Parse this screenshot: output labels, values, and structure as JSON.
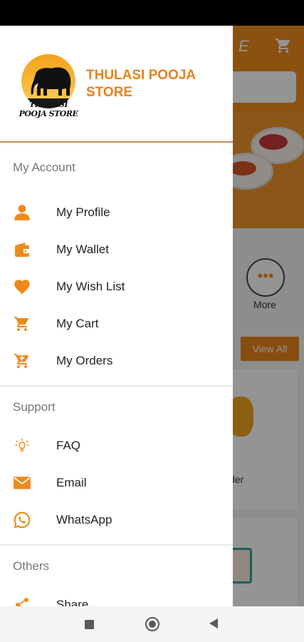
{
  "brand": {
    "name_line1": "THULASI POOJA",
    "name_line2": "STORE",
    "logo_text": "THULASI POOJA STORE",
    "accent_color": "#e6821b"
  },
  "background": {
    "title_fragment": "E",
    "more_label": "More",
    "view_all_label": "View All",
    "card_label_fragment": "der"
  },
  "drawer": {
    "sections": [
      {
        "title": "My Account",
        "items": [
          {
            "label": "My Profile",
            "icon": "person-icon"
          },
          {
            "label": "My Wallet",
            "icon": "wallet-icon"
          },
          {
            "label": "My Wish List",
            "icon": "heart-icon"
          },
          {
            "label": "My Cart",
            "icon": "cart-icon"
          },
          {
            "label": "My Orders",
            "icon": "orders-cart-icon"
          }
        ]
      },
      {
        "title": "Support",
        "items": [
          {
            "label": "FAQ",
            "icon": "lightbulb-icon"
          },
          {
            "label": "Email",
            "icon": "mail-icon"
          },
          {
            "label": "WhatsApp",
            "icon": "whatsapp-icon"
          }
        ]
      },
      {
        "title": "Others",
        "items": [
          {
            "label": "Share",
            "icon": "share-icon"
          }
        ]
      }
    ]
  }
}
